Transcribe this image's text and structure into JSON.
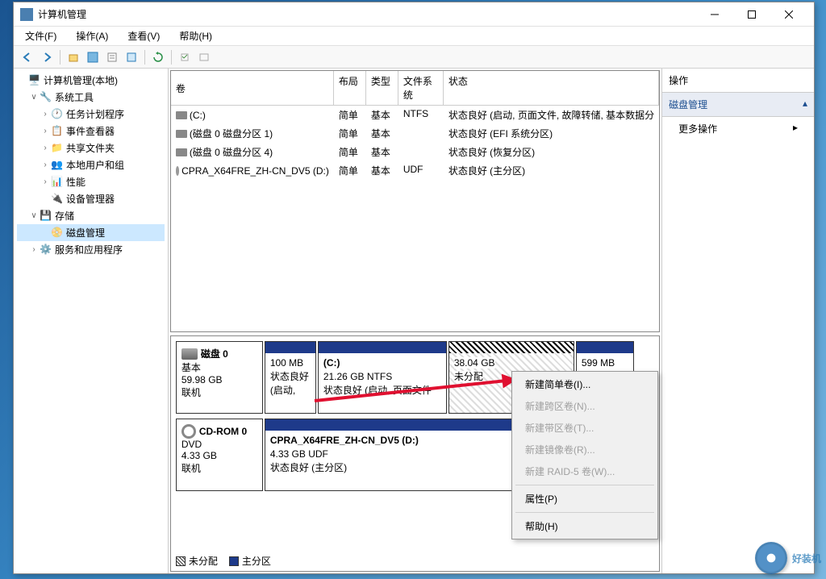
{
  "window": {
    "title": "计算机管理"
  },
  "menu": {
    "file": "文件(F)",
    "action": "操作(A)",
    "view": "查看(V)",
    "help": "帮助(H)"
  },
  "tree": {
    "root": "计算机管理(本地)",
    "systools": "系统工具",
    "scheduler": "任务计划程序",
    "eventviewer": "事件查看器",
    "sharedfolders": "共享文件夹",
    "localusers": "本地用户和组",
    "performance": "性能",
    "devmgr": "设备管理器",
    "storage": "存储",
    "diskmgmt": "磁盘管理",
    "services": "服务和应用程序"
  },
  "table": {
    "headers": {
      "volume": "卷",
      "layout": "布局",
      "type": "类型",
      "fs": "文件系统",
      "status": "状态"
    },
    "rows": [
      {
        "vol": "(C:)",
        "layout": "简单",
        "type": "基本",
        "fs": "NTFS",
        "status": "状态良好 (启动, 页面文件, 故障转储, 基本数据分",
        "icon": "disk"
      },
      {
        "vol": "(磁盘 0 磁盘分区 1)",
        "layout": "简单",
        "type": "基本",
        "fs": "",
        "status": "状态良好 (EFI 系统分区)",
        "icon": "disk"
      },
      {
        "vol": "(磁盘 0 磁盘分区 4)",
        "layout": "简单",
        "type": "基本",
        "fs": "",
        "status": "状态良好 (恢复分区)",
        "icon": "disk"
      },
      {
        "vol": "CPRA_X64FRE_ZH-CN_DV5 (D:)",
        "layout": "简单",
        "type": "基本",
        "fs": "UDF",
        "status": "状态良好 (主分区)",
        "icon": "cd"
      }
    ]
  },
  "disks": {
    "disk0": {
      "name": "磁盘 0",
      "type": "基本",
      "size": "59.98 GB",
      "status": "联机"
    },
    "cdrom0": {
      "name": "CD-ROM 0",
      "type": "DVD",
      "size": "4.33 GB",
      "status": "联机"
    }
  },
  "partitions": {
    "p1": {
      "size": "100 MB",
      "status": "状态良好 (启动,"
    },
    "p2": {
      "label": "(C:)",
      "size": "21.26 GB NTFS",
      "status": "状态良好 (启动, 页面文件"
    },
    "p3": {
      "size": "38.04 GB",
      "status": "未分配"
    },
    "p4": {
      "size": "599 MB"
    },
    "cd": {
      "label": "CPRA_X64FRE_ZH-CN_DV5  (D:)",
      "size": "4.33 GB UDF",
      "status": "状态良好 (主分区)"
    }
  },
  "legend": {
    "unalloc": "未分配",
    "primary": "主分区"
  },
  "actions": {
    "title": "操作",
    "section": "磁盘管理",
    "more": "更多操作"
  },
  "context": {
    "newsimple": "新建简单卷(I)...",
    "newspan": "新建跨区卷(N)...",
    "newstripe": "新建带区卷(T)...",
    "newmirror": "新建镜像卷(R)...",
    "newraid5": "新建 RAID-5 卷(W)...",
    "properties": "属性(P)",
    "help": "帮助(H)"
  },
  "watermark": "好装机"
}
